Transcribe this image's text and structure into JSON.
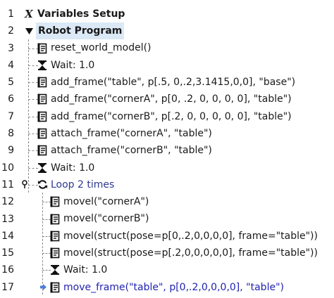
{
  "program": {
    "lines": [
      {
        "num": "1",
        "text": "Variables Setup"
      },
      {
        "num": "2",
        "text": "Robot Program"
      },
      {
        "num": "3",
        "text": "reset_world_model()"
      },
      {
        "num": "4",
        "text": "Wait: 1.0"
      },
      {
        "num": "5",
        "text": "add_frame(\"table\", p[.5, 0,.2,3.1415,0,0], \"base\")"
      },
      {
        "num": "6",
        "text": "add_frame(\"cornerA\", p[0, .2, 0, 0, 0, 0], \"table\")"
      },
      {
        "num": "7",
        "text": "add_frame(\"cornerB\", p[.2, 0, 0, 0, 0, 0], \"table\")"
      },
      {
        "num": "8",
        "text": "attach_frame(\"cornerA\", \"table\")"
      },
      {
        "num": "9",
        "text": "attach_frame(\"cornerB\", \"table\")"
      },
      {
        "num": "10",
        "text": "Wait: 1.0"
      },
      {
        "num": "11",
        "text": "Loop 2 times"
      },
      {
        "num": "12",
        "text": "movel(\"cornerA\")"
      },
      {
        "num": "13",
        "text": "movel(\"cornerB\")"
      },
      {
        "num": "14",
        "text": "movel(struct(pose=p[0,.2,0,0,0,0], frame=\"table\"))"
      },
      {
        "num": "15",
        "text": "movel(struct(pose=p[.2,0,0,0,0,0], frame=\"table\"))"
      },
      {
        "num": "16",
        "text": "Wait: 1.0"
      },
      {
        "num": "17",
        "text": "move_frame(\"table\", p[0,.2,0,0,0,0], \"table\")"
      }
    ]
  },
  "icons": {
    "variables": "variables-x-icon",
    "expand": "triangle-down-icon",
    "script": "script-icon",
    "wait": "hourglass-icon",
    "loop": "loop-arrows-icon",
    "breakpoint": "pin-icon",
    "current": "arrow-right-icon"
  },
  "colors": {
    "selected_background": "#dbe8f5",
    "loop_text": "#2e3a8f",
    "current_text": "#2222b0",
    "current_marker": "#4a7fd4"
  }
}
